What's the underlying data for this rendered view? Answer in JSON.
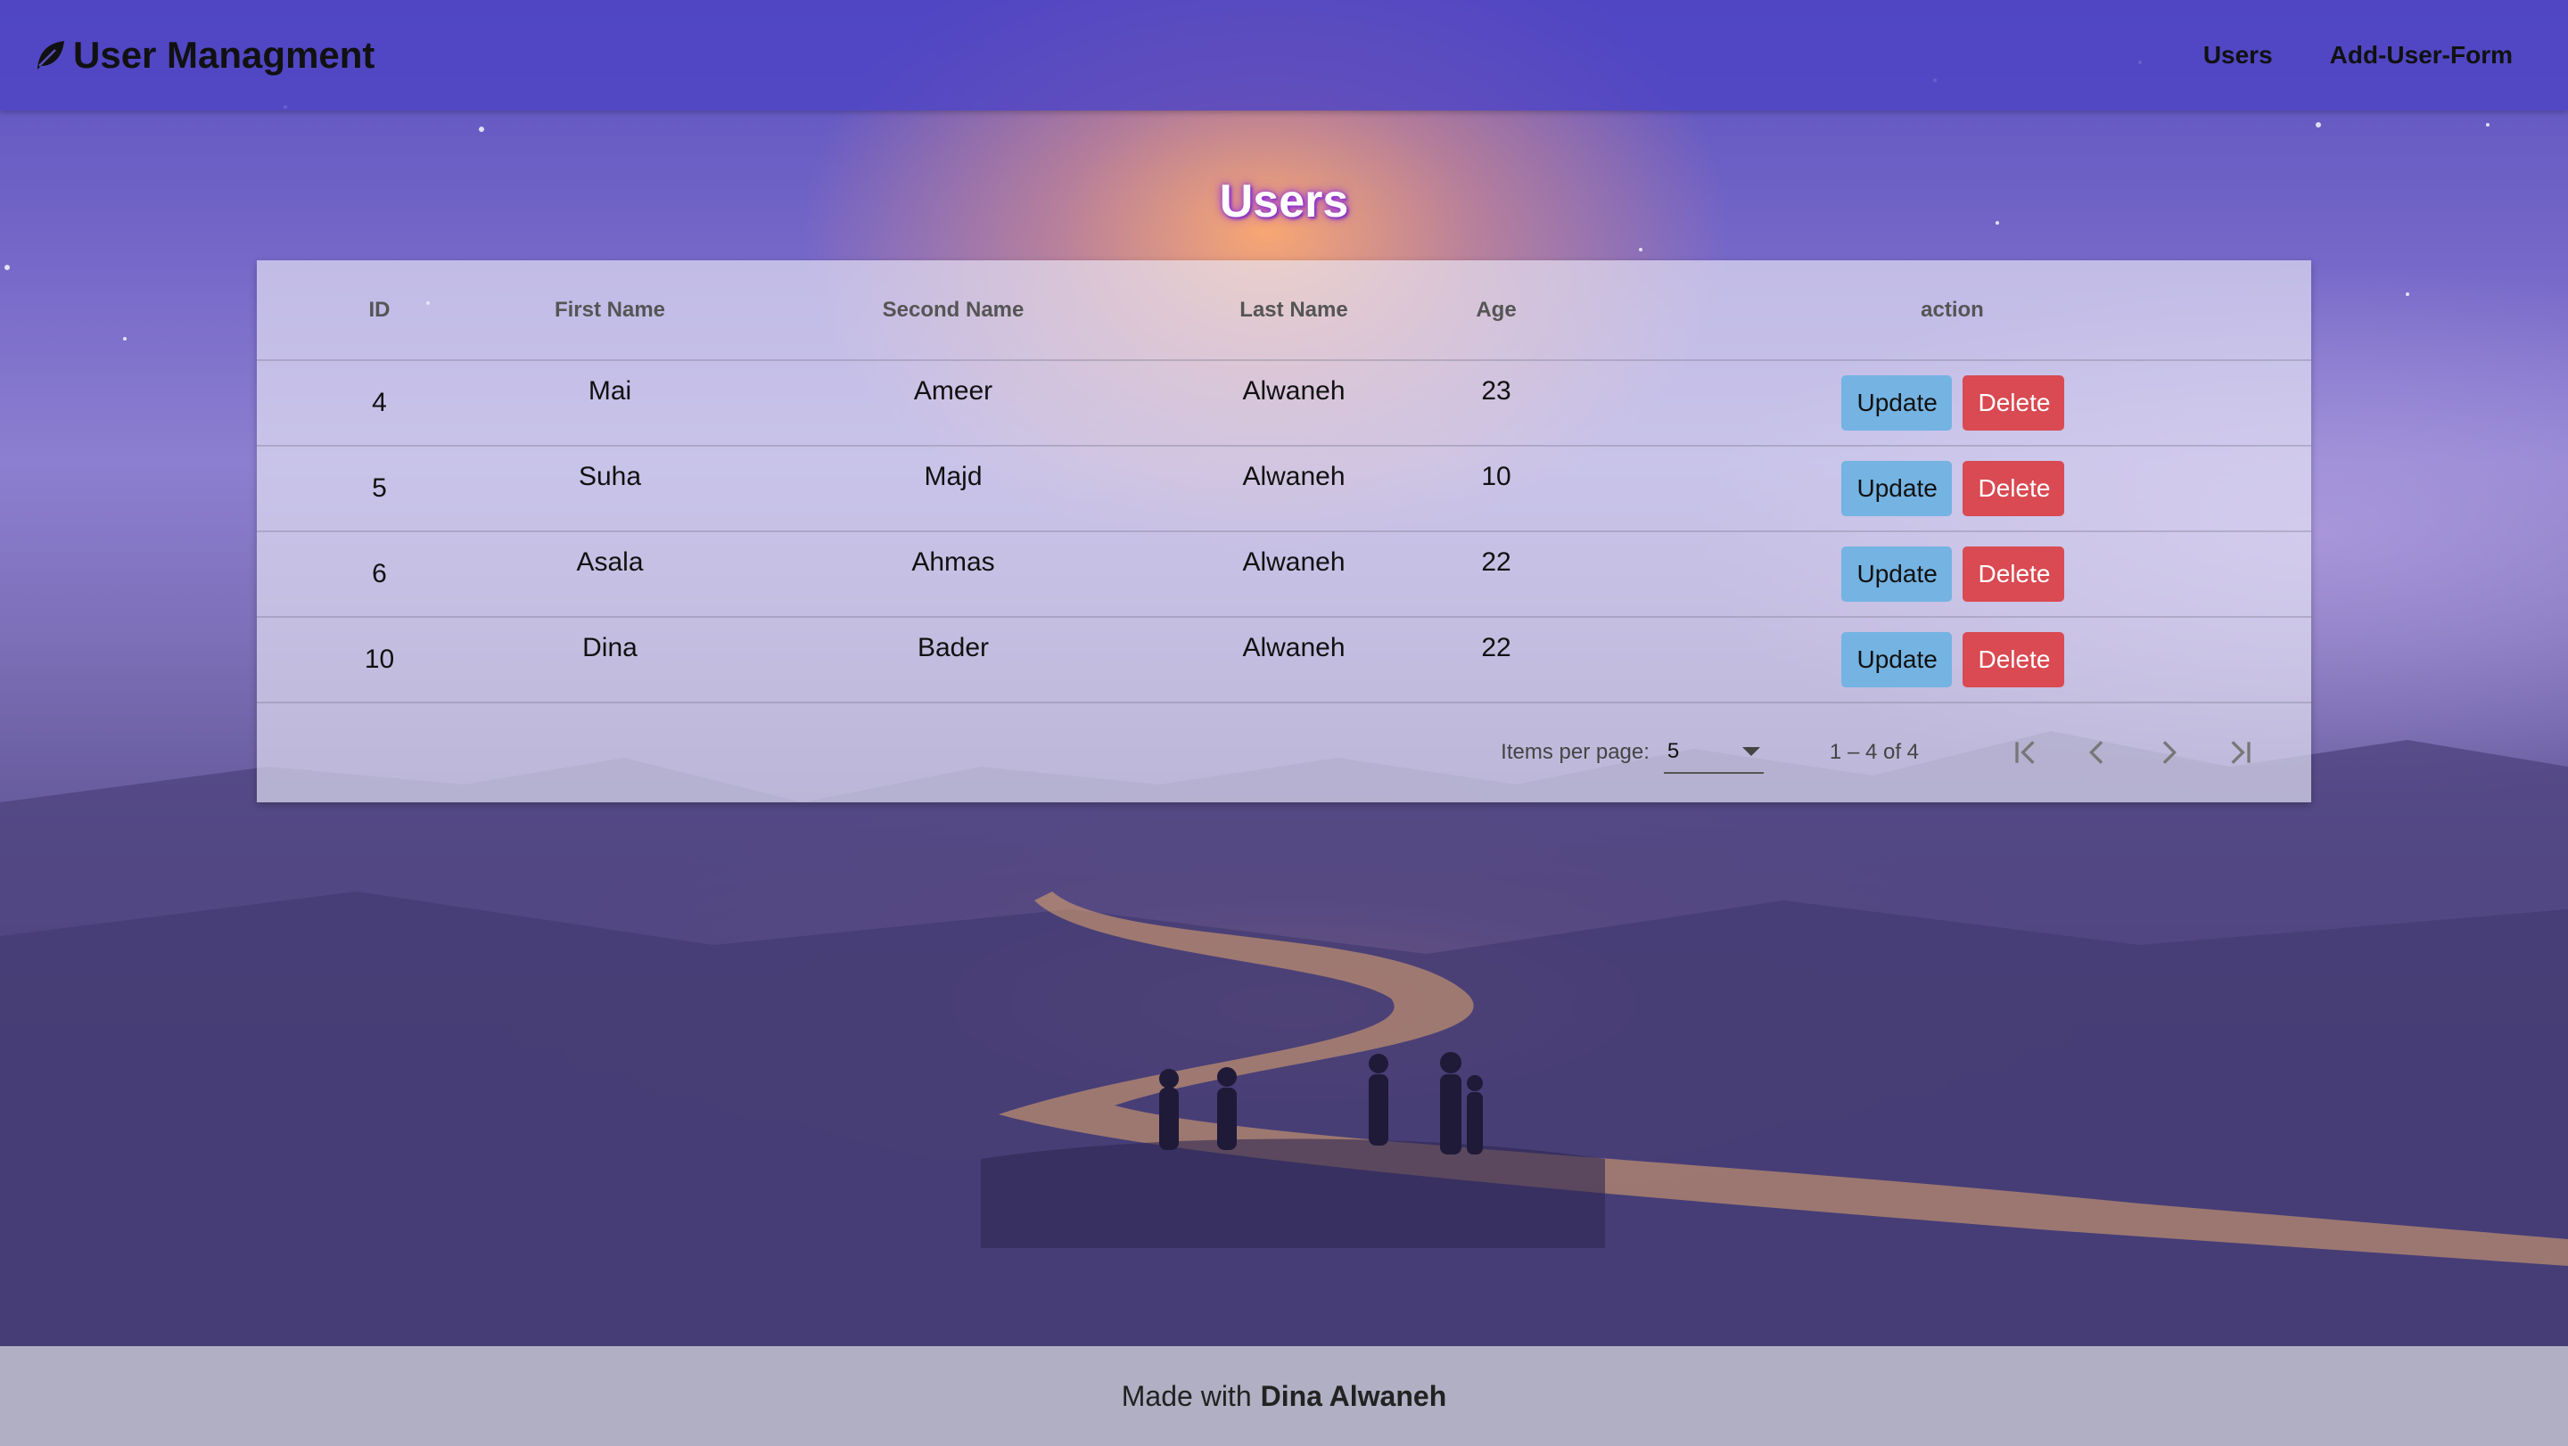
{
  "navbar": {
    "brand": "User Managment",
    "brand_icon": "leaf-icon",
    "links": [
      "Users",
      "Add-User-Form"
    ]
  },
  "heading": "Users",
  "table": {
    "columns": [
      "ID",
      "First Name",
      "Second Name",
      "Last Name",
      "Age",
      "action"
    ],
    "rows": [
      {
        "id": "4",
        "first": "Mai",
        "second": "Ameer",
        "last": "Alwaneh",
        "age": "23"
      },
      {
        "id": "5",
        "first": "Suha",
        "second": "Majd",
        "last": "Alwaneh",
        "age": "10"
      },
      {
        "id": "6",
        "first": "Asala",
        "second": "Ahmas",
        "last": "Alwaneh",
        "age": "22"
      },
      {
        "id": "10",
        "first": "Dina",
        "second": "Bader",
        "last": "Alwaneh",
        "age": "22"
      }
    ],
    "update_label": "Update",
    "delete_label": "Delete"
  },
  "paginator": {
    "items_per_page_label": "Items per page:",
    "page_size": "5",
    "range": "1 – 4 of 4"
  },
  "footer": {
    "prefix": "Made with",
    "author": "Dina Alwaneh"
  },
  "colors": {
    "navbar": "#4e44c4",
    "update_button": "#74b3e2",
    "delete_button": "#d94a52"
  }
}
